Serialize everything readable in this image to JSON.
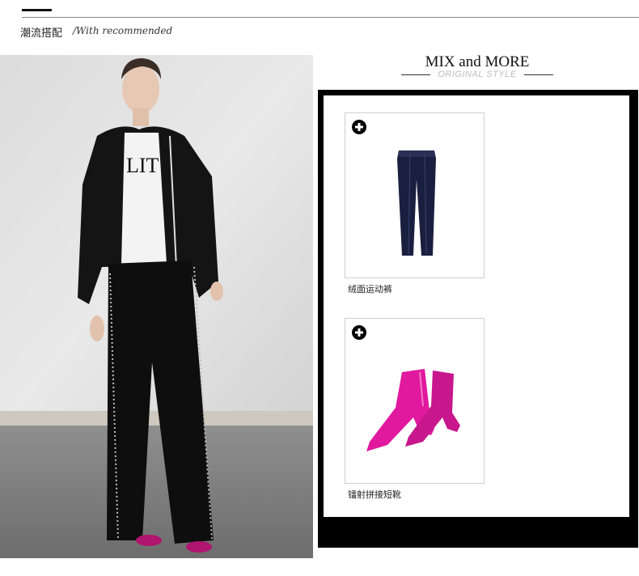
{
  "section": {
    "title": "潮流搭配",
    "subtitle": "/With recommended"
  },
  "mix": {
    "title": "MIX and MORE",
    "subtitle": "ORIGINAL STYLE"
  },
  "products": [
    {
      "name": "绒面运动裤",
      "icon": "plus-circle-icon",
      "image": "velvet-track-pants"
    },
    {
      "name": "镭射拼接短靴",
      "icon": "plus-circle-icon",
      "image": "metallic-pink-ankle-boots"
    }
  ],
  "colors": {
    "panel_border": "#000000",
    "boot_pink": "#e0199e",
    "pants_navy": "#1b1f3f"
  }
}
